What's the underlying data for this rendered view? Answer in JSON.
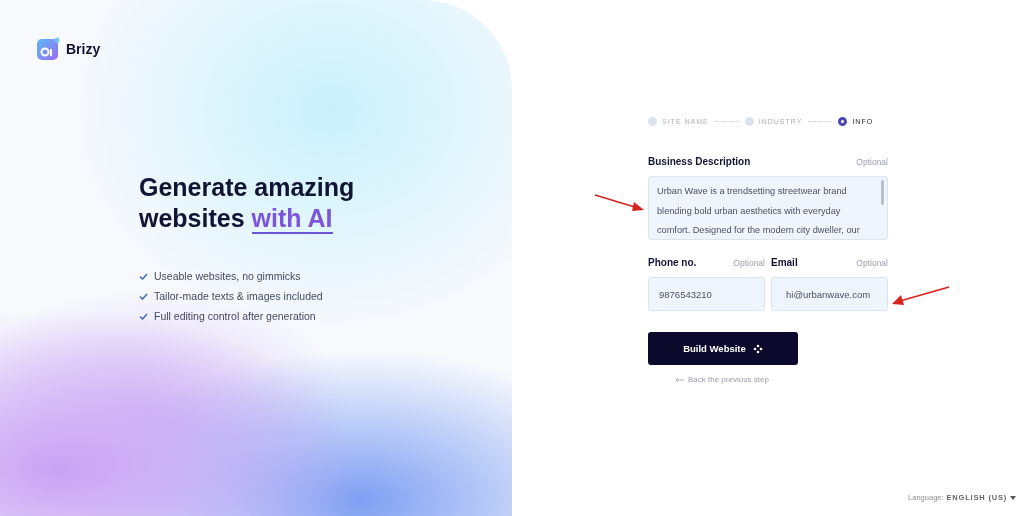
{
  "brand": {
    "name": "Brizy"
  },
  "hero": {
    "title": "Generate amazing websites",
    "highlight": "with AI",
    "features": [
      "Useable websites, no gimmicks",
      "Tailor-made texts & images included",
      "Full editing control after generation"
    ]
  },
  "steps": [
    {
      "label": "SITE NAME",
      "selected": false
    },
    {
      "label": "INDUSTRY",
      "selected": false
    },
    {
      "label": "INFO",
      "selected": true
    }
  ],
  "form": {
    "description": {
      "label": "Business Description",
      "hint": "Optional",
      "value": "Urban Wave is a trendsetting streetwear brand blending bold urban aesthetics with everyday comfort. Designed for the modern city dweller, our"
    },
    "phone": {
      "label": "Phone no.",
      "hint": "Optional",
      "value": "9876543210"
    },
    "email": {
      "label": "Email",
      "hint": "Optional",
      "value": "hi@urbanwave.com"
    },
    "submit": "Build Website",
    "back": "Back the previous step"
  },
  "language": {
    "label": "Language:",
    "value": "ENGLISH (US)"
  }
}
